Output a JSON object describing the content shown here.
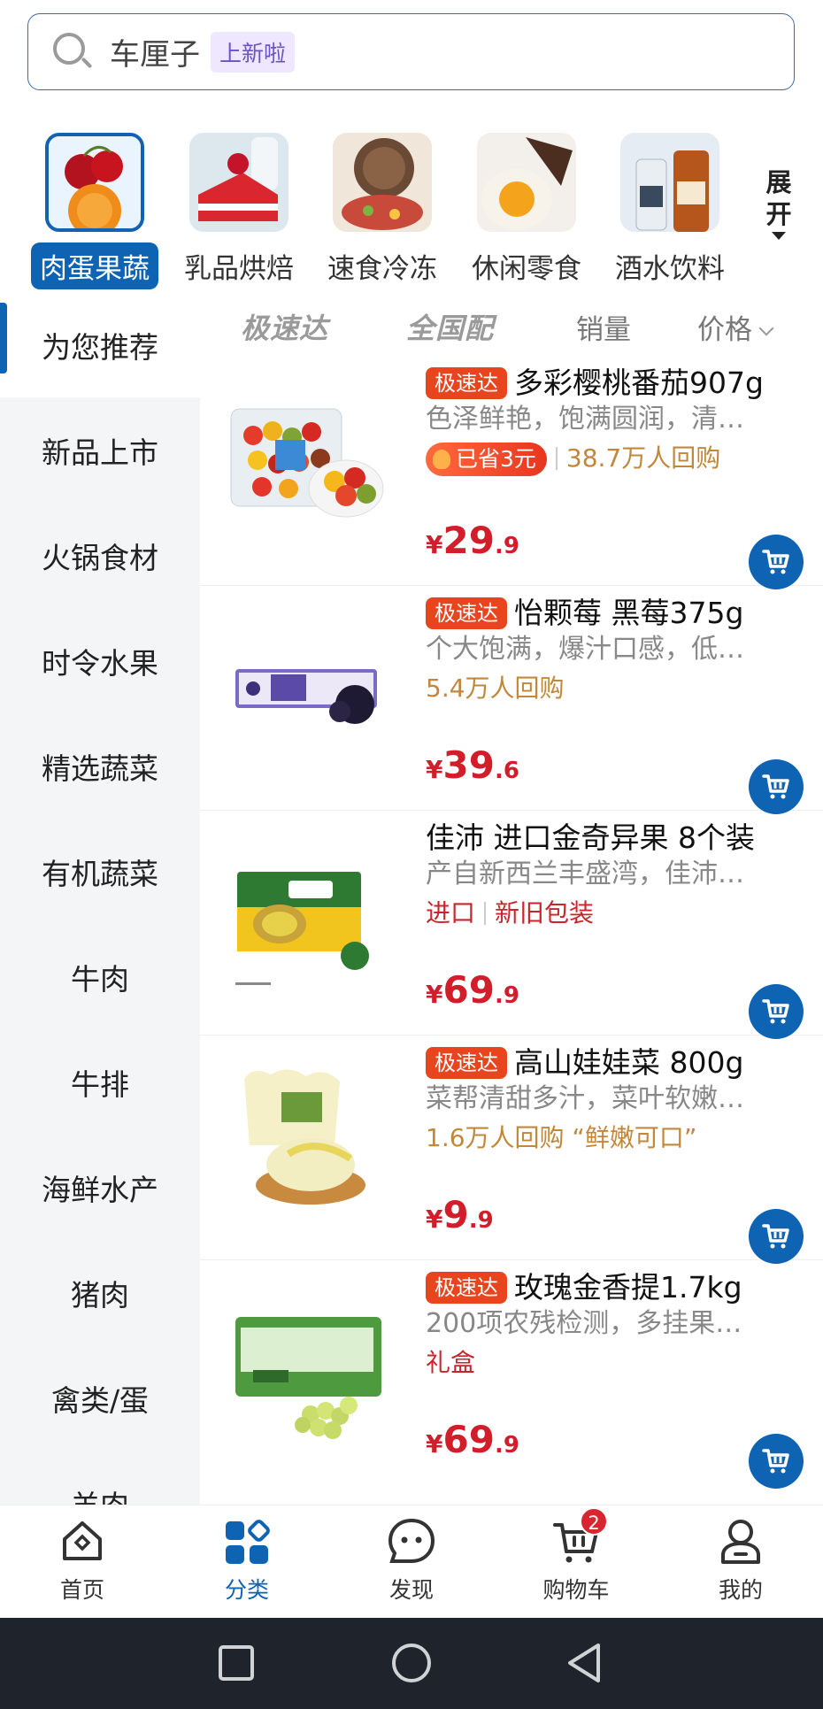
{
  "search": {
    "text": "车厘子",
    "tag": "上新啦"
  },
  "categories": [
    {
      "label": "肉蛋果蔬",
      "icon": "fruit-thumbnail",
      "active": true
    },
    {
      "label": "乳品烘焙",
      "icon": "cake-thumbnail"
    },
    {
      "label": "速食冷冻",
      "icon": "frozen-food-thumbnail"
    },
    {
      "label": "休闲零食",
      "icon": "snack-thumbnail"
    },
    {
      "label": "酒水饮料",
      "icon": "liquor-thumbnail"
    }
  ],
  "expand_label": "展开",
  "sidebar": {
    "items": [
      "为您推荐",
      "新品上市",
      "火锅食材",
      "时令水果",
      "精选蔬菜",
      "有机蔬菜",
      "牛肉",
      "牛排",
      "海鲜水产",
      "猪肉",
      "禽类/蛋",
      "羊肉"
    ],
    "active_index": 0
  },
  "sortbar": {
    "express": "极速达",
    "national": "全国配",
    "sales": "销量",
    "price": "价格"
  },
  "products": [
    {
      "badge": "极速达",
      "title": "多彩樱桃番茄907g",
      "desc": "色泽鲜艳，饱满圆润，清…",
      "saved": "已省3元",
      "repurchase": "38.7万人回购",
      "price_int": "29",
      "price_dec": ".9",
      "price_sym": "¥"
    },
    {
      "badge": "极速达",
      "title": "怡颗莓 黑莓375g",
      "desc": "个大饱满，爆汁口感，低…",
      "repurchase": "5.4万人回购",
      "price_int": "39",
      "price_dec": ".6",
      "price_sym": "¥"
    },
    {
      "title": "佳沛 进口金奇异果 8个装",
      "desc": "产自新西兰丰盛湾，佳沛…",
      "tag1": "进口",
      "tag2": "新旧包装",
      "price_int": "69",
      "price_dec": ".9",
      "price_sym": "¥"
    },
    {
      "badge": "极速达",
      "title": "高山娃娃菜 800g",
      "desc": "菜帮清甜多汁，菜叶软嫩…",
      "repurchase": "1.6万人回购 “鲜嫩可口”",
      "price_int": "9",
      "price_dec": ".9",
      "price_sym": "¥"
    },
    {
      "badge": "极速达",
      "title": "玫瑰金香提1.7kg",
      "desc": "200项农残检测，多挂果…",
      "tag1": "礼盒",
      "price_int": "69",
      "price_dec": ".9",
      "price_sym": "¥"
    }
  ],
  "bottom_nav": [
    {
      "label": "首页",
      "icon": "home-icon"
    },
    {
      "label": "分类",
      "icon": "category-icon",
      "active": true
    },
    {
      "label": "发现",
      "icon": "discover-icon"
    },
    {
      "label": "购物车",
      "icon": "cart-icon",
      "badge": "2"
    },
    {
      "label": "我的",
      "icon": "profile-icon"
    }
  ],
  "colors": {
    "brand": "#0f63b3",
    "price": "#d21e2b",
    "express_badge": "#e8451f",
    "repurchase": "#c1883b"
  }
}
